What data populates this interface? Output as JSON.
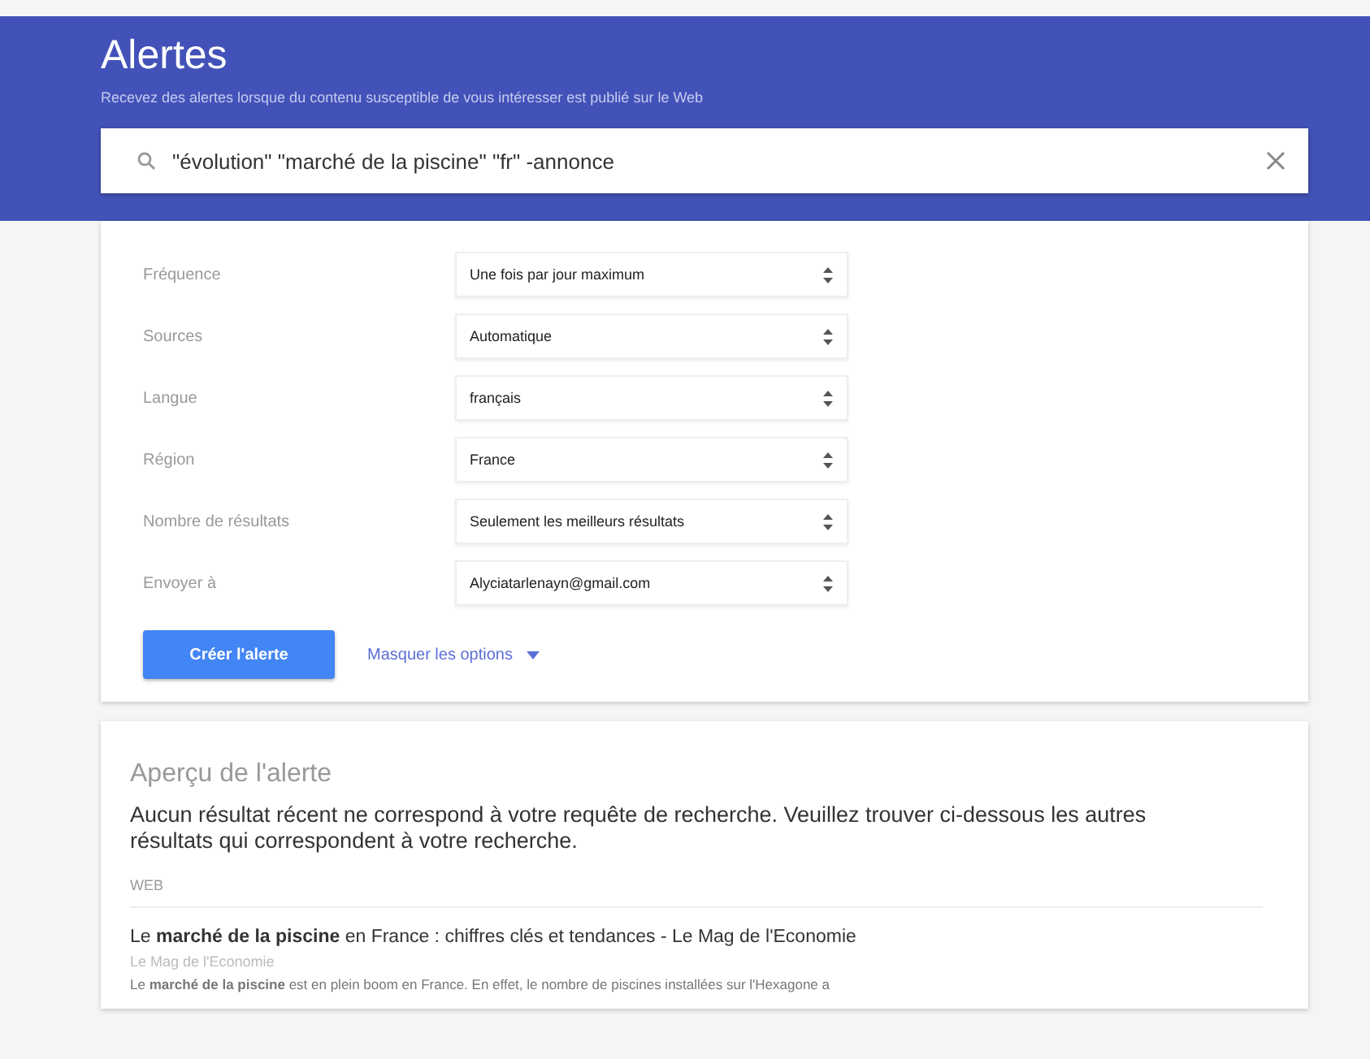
{
  "header": {
    "title": "Alertes",
    "subtitle": "Recevez des alertes lorsque du contenu susceptible de vous intéresser est publié sur le Web"
  },
  "search": {
    "value": "\"évolution\" \"marché de la piscine\" \"fr\" -annonce"
  },
  "options": [
    {
      "label": "Fréquence",
      "value": "Une fois par jour maximum"
    },
    {
      "label": "Sources",
      "value": "Automatique"
    },
    {
      "label": "Langue",
      "value": "français"
    },
    {
      "label": "Région",
      "value": "France"
    },
    {
      "label": "Nombre de résultats",
      "value": "Seulement les meilleurs résultats"
    },
    {
      "label": "Envoyer à",
      "value": "Alyciatarlenayn@gmail.com"
    }
  ],
  "create_button": "Créer l'alerte",
  "toggle_link": "Masquer les options",
  "preview": {
    "title": "Aperçu de l'alerte",
    "message": "Aucun résultat récent ne correspond à votre requête de recherche. Veuillez trouver ci-dessous les autres résultats qui correspondent à votre recherche.",
    "section": "WEB",
    "results": [
      {
        "title": "Le **marché de la piscine** en France : chiffres clés et tendances - Le Mag de l'Economie",
        "source": "Le Mag de l'Economie",
        "snippet": "Le **marché de la piscine** est en plein boom en France. En effet, le nombre de piscines installées sur l'Hexagone a"
      }
    ]
  }
}
